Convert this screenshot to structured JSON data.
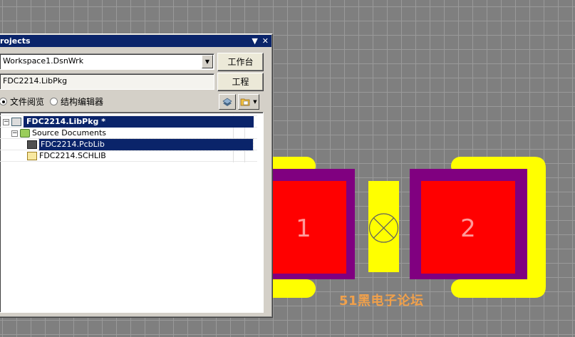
{
  "panel": {
    "title": "rojects",
    "title_icons": {
      "dropdown": "▼",
      "close": "✕"
    },
    "workspace_select": {
      "value": "Workspace1.DsnWrk"
    },
    "project_field": {
      "value": "FDC2214.LibPkg"
    },
    "workspace_button": "工作台",
    "project_button": "工程",
    "view_options": [
      {
        "label": "文件阅览",
        "selected": true
      },
      {
        "label": "结构编辑器",
        "selected": false
      }
    ],
    "tree": {
      "project": {
        "label": "FDC2214.LibPkg *",
        "icon": "library-package-icon"
      },
      "folder": {
        "label": "Source Documents",
        "icon": "folder-icon"
      },
      "files": [
        {
          "label": "FDC2214.PcbLib",
          "icon": "pcb-library-icon",
          "selected": true
        },
        {
          "label": "FDC2214.SCHLIB",
          "icon": "schematic-library-icon",
          "selected": false
        }
      ]
    }
  },
  "canvas": {
    "pads": [
      {
        "designator": "1"
      },
      {
        "designator": "2"
      }
    ],
    "watermark": "51黑电子论坛",
    "colors": {
      "background": "#7f7f7f",
      "grid": "#9a9a9a",
      "pad": "#ff0000",
      "solder_mask": "#800080",
      "silkscreen": "#ffff00",
      "watermark": "#f0a04b"
    }
  }
}
